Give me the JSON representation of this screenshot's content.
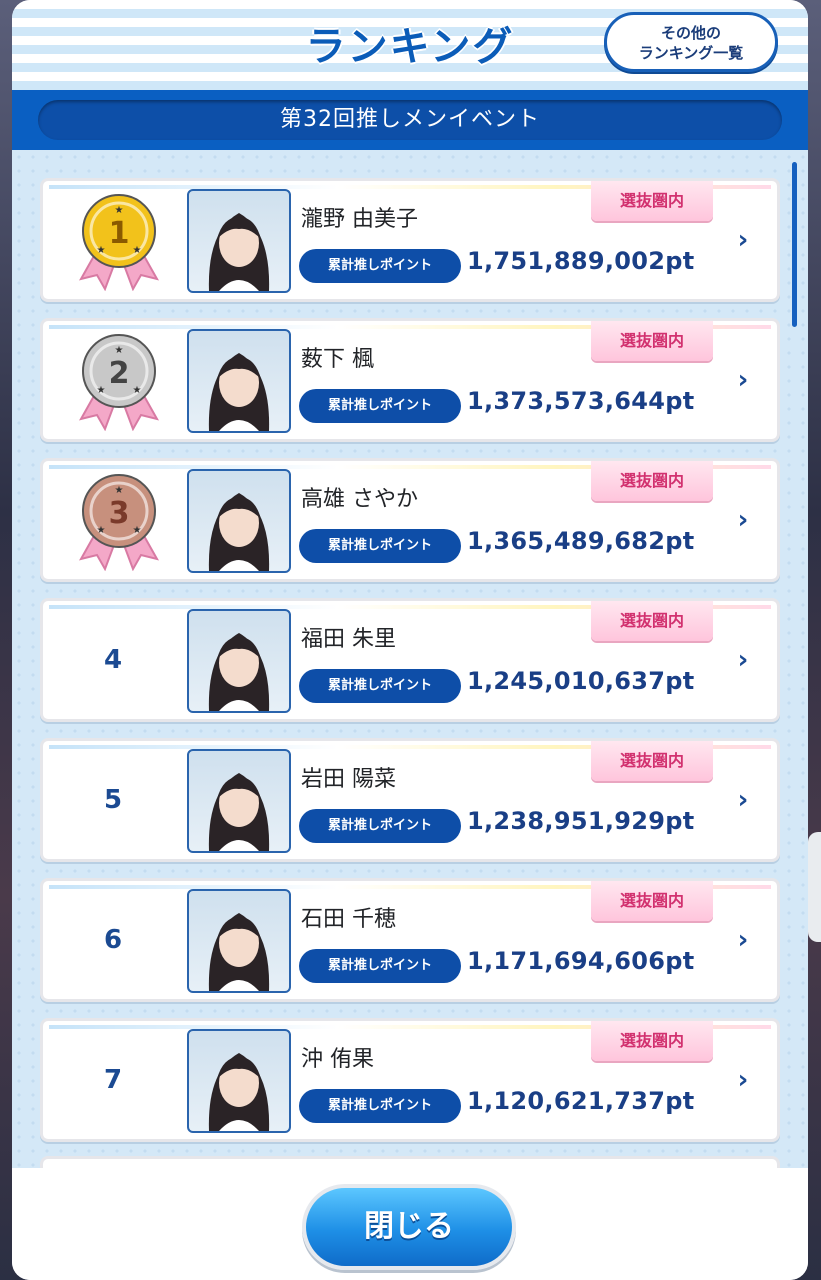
{
  "header": {
    "title": "ランキング",
    "other_button": [
      "その他の",
      "ランキング一覧"
    ]
  },
  "event": {
    "name": "第32回推しメンイベント"
  },
  "labels": {
    "points_badge": "累計推しポイント",
    "selected_tag": "選抜圏内"
  },
  "rankings": [
    {
      "rank": "1",
      "name": "瀧野 由美子",
      "points": "1,751,889,002pt"
    },
    {
      "rank": "2",
      "name": "薮下 楓",
      "points": "1,373,573,644pt"
    },
    {
      "rank": "3",
      "name": "高雄 さやか",
      "points": "1,365,489,682pt"
    },
    {
      "rank": "4",
      "name": "福田 朱里",
      "points": "1,245,010,637pt"
    },
    {
      "rank": "5",
      "name": "岩田 陽菜",
      "points": "1,238,951,929pt"
    },
    {
      "rank": "6",
      "name": "石田 千穂",
      "points": "1,171,694,606pt"
    },
    {
      "rank": "7",
      "name": "沖 侑果",
      "points": "1,120,621,737pt"
    }
  ],
  "footer": {
    "close_label": "閉じる"
  },
  "colors": {
    "primary": "#0a5fc2",
    "gold": "#f2c21b",
    "silver": "#c8c8c8",
    "bronze": "#c7907d",
    "pink_tag": "#d2316f"
  }
}
